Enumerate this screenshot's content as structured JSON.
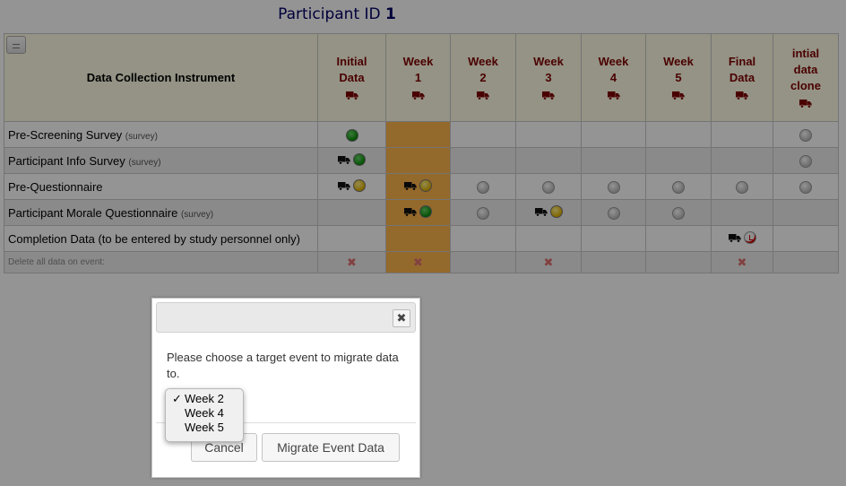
{
  "participant": {
    "label": "Participant ID",
    "id": "1"
  },
  "grid": {
    "instrument_header": "Data Collection Instrument",
    "events": [
      {
        "line1": "Initial",
        "line2": "Data"
      },
      {
        "line1": "Week",
        "line2": "1"
      },
      {
        "line1": "Week",
        "line2": "2"
      },
      {
        "line1": "Week",
        "line2": "3"
      },
      {
        "line1": "Week",
        "line2": "4"
      },
      {
        "line1": "Week",
        "line2": "5"
      },
      {
        "line1": "Final",
        "line2": "Data"
      },
      {
        "line1": "intial",
        "line2": "data",
        "line3": "clone"
      }
    ],
    "rows": [
      {
        "name": "Pre-Screening Survey",
        "tag": "(survey)"
      },
      {
        "name": "Participant Info Survey",
        "tag": "(survey)"
      },
      {
        "name": "Pre-Questionnaire",
        "tag": ""
      },
      {
        "name": "Participant Morale Questionnaire",
        "tag": "(survey)"
      },
      {
        "name": "Completion Data (to be entered by study personnel only)",
        "tag": ""
      }
    ],
    "delete_row_label": "Delete all data on event:",
    "delete_icon": "✖",
    "highlight_color": "#ffb64d"
  },
  "dialog": {
    "message": "Please choose a target event to migrate data to.",
    "close_glyph": "✖",
    "cancel_label": "Cancel",
    "migrate_label": "Migrate Event Data"
  },
  "select": {
    "check_glyph": "✓",
    "options": [
      "Week 2",
      "Week 4",
      "Week 5"
    ],
    "selected": "Week 2"
  },
  "icons": {
    "truck": "truck-icon",
    "status_green": "complete",
    "status_yellow": "unverified",
    "status_gray": "no-data",
    "status_red": "incomplete"
  }
}
